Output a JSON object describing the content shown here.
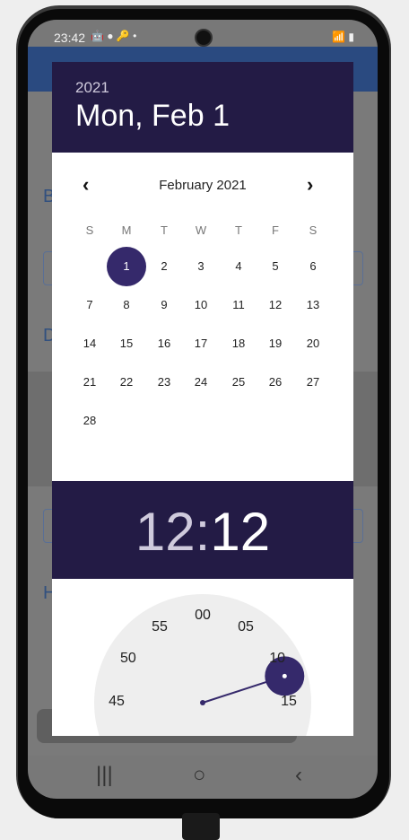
{
  "status_bar": {
    "time": "23:42",
    "icons_left": "🤖 ● 🔑 •",
    "icons_right": "📶 ▮"
  },
  "date_picker": {
    "year": "2021",
    "selected_date": "Mon, Feb 1",
    "month_label": "February 2021",
    "prev_icon": "‹",
    "next_icon": "›",
    "weekdays": [
      "S",
      "M",
      "T",
      "W",
      "T",
      "F",
      "S"
    ],
    "days": [
      "1",
      "2",
      "3",
      "4",
      "5",
      "6",
      "7",
      "8",
      "9",
      "10",
      "11",
      "12",
      "13",
      "14",
      "15",
      "16",
      "17",
      "18",
      "19",
      "20",
      "21",
      "22",
      "23",
      "24",
      "25",
      "26",
      "27",
      "28"
    ],
    "first_weekday_index": 1,
    "selected_day": "1"
  },
  "time_picker": {
    "hours": "12",
    "separator": ":",
    "minutes": "12",
    "minute_labels": [
      "00",
      "05",
      "10",
      "15",
      "45",
      "50",
      "55"
    ],
    "selected_minute": 12
  },
  "colors": {
    "header": "#231b45",
    "accent": "#35296b",
    "clock_face": "#eeeeee"
  },
  "nav": {
    "recents_icon": "|||",
    "home_icon": "○",
    "back_icon": "‹"
  }
}
